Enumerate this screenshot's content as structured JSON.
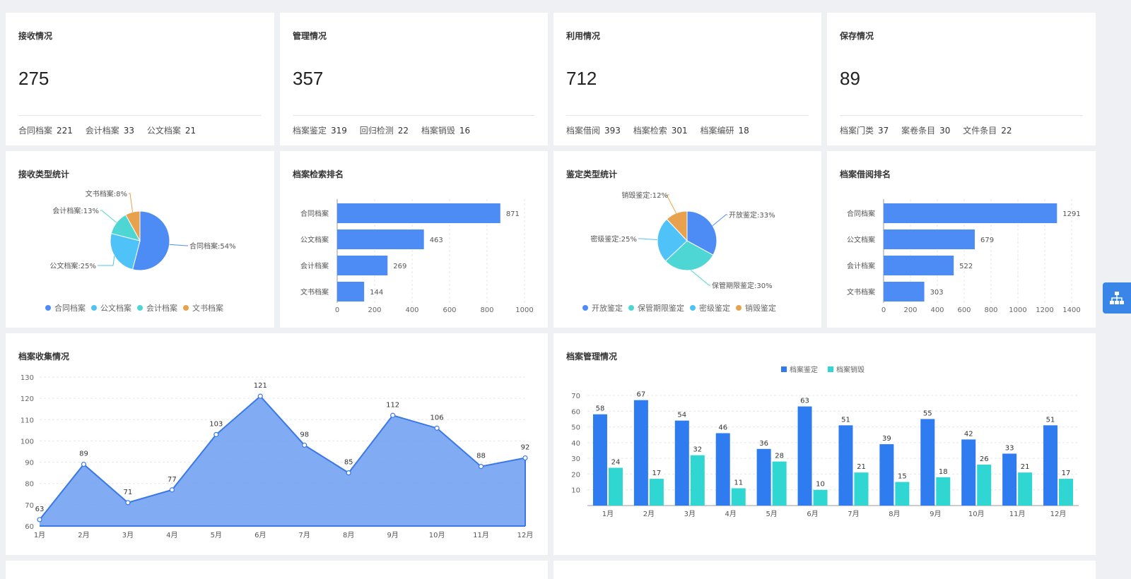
{
  "colors": {
    "blue": "#4e8cf5",
    "cyan": "#4fc3f7",
    "teal": "#4dd6d4",
    "orange": "#e8a24e",
    "bar_blue": "#4e8cf5",
    "bar_dark": "#2f7bf0",
    "bar_teal": "#2fd6d2",
    "area": "#6b9ef2"
  },
  "stats": [
    {
      "title": "接收情况",
      "value": "275",
      "details": [
        {
          "label": "合同档案",
          "value": "221"
        },
        {
          "label": "会计档案",
          "value": "33"
        },
        {
          "label": "公文档案",
          "value": "21"
        }
      ]
    },
    {
      "title": "管理情况",
      "value": "357",
      "details": [
        {
          "label": "档案鉴定",
          "value": "319"
        },
        {
          "label": "回归检测",
          "value": "22"
        },
        {
          "label": "档案销毁",
          "value": "16"
        }
      ]
    },
    {
      "title": "利用情况",
      "value": "712",
      "details": [
        {
          "label": "档案借阅",
          "value": "393"
        },
        {
          "label": "档案检索",
          "value": "301"
        },
        {
          "label": "档案编研",
          "value": "18"
        }
      ]
    },
    {
      "title": "保存情况",
      "value": "89",
      "details": [
        {
          "label": "档案门类",
          "value": "37"
        },
        {
          "label": "案卷条目",
          "value": "30"
        },
        {
          "label": "文件条目",
          "value": "22"
        }
      ]
    }
  ],
  "chart_titles": {
    "receive": "接收类型统计",
    "search": "档案检索排名",
    "appraise": "鉴定类型统计",
    "borrow": "档案借阅排名",
    "collect": "档案收集情况",
    "manage": "档案管理情况"
  },
  "icons": {
    "side": "sitemap-icon"
  },
  "chart_data": [
    {
      "type": "pie",
      "title": "接收类型统计",
      "slices": [
        {
          "name": "合同档案",
          "value": 54
        },
        {
          "name": "公文档案",
          "value": 25
        },
        {
          "name": "会计档案",
          "value": 13
        },
        {
          "name": "文书档案",
          "value": 8
        }
      ],
      "labels": [
        "合同档案:54%",
        "公文档案:25%",
        "会计档案:13%",
        "文书档案:8%"
      ],
      "legend": "bottom"
    },
    {
      "type": "bar",
      "title": "档案检索排名",
      "orientation": "horizontal",
      "categories": [
        "合同档案",
        "公文档案",
        "会计档案",
        "文书档案"
      ],
      "values": [
        871,
        463,
        269,
        144
      ],
      "xlim": [
        0,
        1000
      ],
      "ticks": [
        "0",
        "200",
        "400",
        "600",
        "800",
        "1000"
      ]
    },
    {
      "type": "pie",
      "title": "鉴定类型统计",
      "slices": [
        {
          "name": "开放鉴定",
          "value": 33
        },
        {
          "name": "保管期限鉴定",
          "value": 30
        },
        {
          "name": "密级鉴定",
          "value": 25
        },
        {
          "name": "销毁鉴定",
          "value": 12
        }
      ],
      "labels": [
        "开放鉴定:33%",
        "保管期限鉴定:30%",
        "密级鉴定:25%",
        "销毁鉴定:12%"
      ],
      "legend": "bottom"
    },
    {
      "type": "bar",
      "title": "档案借阅排名",
      "orientation": "horizontal",
      "categories": [
        "合同档案",
        "公文档案",
        "会计档案",
        "文书档案"
      ],
      "values": [
        1291,
        679,
        522,
        303
      ],
      "xlim": [
        0,
        1400
      ],
      "ticks": [
        "0",
        "200",
        "400",
        "600",
        "800",
        "1000",
        "1200",
        "1400"
      ]
    },
    {
      "type": "area",
      "title": "档案收集情况",
      "categories": [
        "1月",
        "2月",
        "3月",
        "4月",
        "5月",
        "6月",
        "7月",
        "8月",
        "9月",
        "10月",
        "11月",
        "12月"
      ],
      "values": [
        63,
        89,
        71,
        77,
        103,
        121,
        98,
        85,
        112,
        106,
        88,
        92
      ],
      "ylim": [
        60,
        130
      ],
      "ticks": [
        "60",
        "70",
        "80",
        "90",
        "100",
        "110",
        "120",
        "130"
      ]
    },
    {
      "type": "bar",
      "title": "档案管理情况",
      "categories": [
        "1月",
        "2月",
        "3月",
        "4月",
        "5月",
        "6月",
        "7月",
        "8月",
        "9月",
        "10月",
        "11月",
        "12月"
      ],
      "series": [
        {
          "name": "档案鉴定",
          "values": [
            58,
            67,
            54,
            46,
            36,
            63,
            51,
            39,
            55,
            42,
            33,
            51
          ]
        },
        {
          "name": "档案销毁",
          "values": [
            24,
            17,
            32,
            11,
            28,
            10,
            21,
            15,
            18,
            26,
            21,
            17
          ]
        }
      ],
      "ylim": [
        0,
        70
      ],
      "ticks": [
        "10",
        "20",
        "30",
        "40",
        "50",
        "60",
        "70"
      ],
      "legend": "top"
    }
  ]
}
